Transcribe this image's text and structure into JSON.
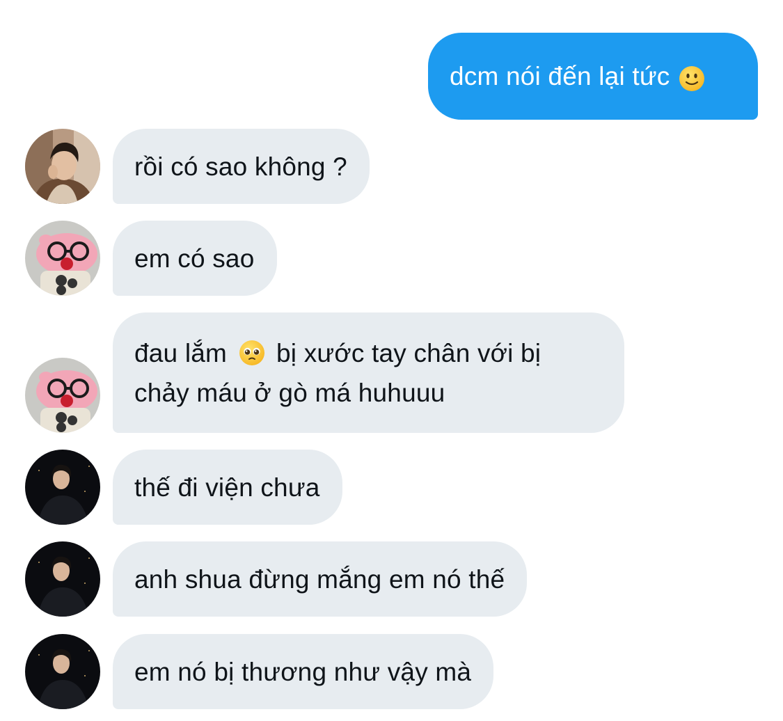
{
  "conversation": {
    "messages": [
      {
        "direction": "outgoing",
        "text": "dcm nói đến lại tức",
        "emoji": "slightly-smiling-face-icon"
      },
      {
        "direction": "incoming",
        "avatar": "avatar-man-brown-coat",
        "text": "rồi có sao không ?"
      },
      {
        "direction": "incoming",
        "avatar": "avatar-pink-plush-glasses",
        "text": "em có sao"
      },
      {
        "direction": "incoming",
        "avatar": "avatar-pink-plush-glasses",
        "lines": [
          "đau lắm",
          "bị xước tay chân với bị",
          "chảy máu ở gò má huhuuu"
        ],
        "emoji": "pleading-face-icon"
      },
      {
        "direction": "incoming",
        "avatar": "avatar-man-dark-background",
        "text": "thế đi viện chưa"
      },
      {
        "direction": "incoming",
        "avatar": "avatar-man-dark-background",
        "text": "anh shua đừng mắng em nó thế"
      },
      {
        "direction": "incoming",
        "avatar": "avatar-man-dark-background",
        "text": "em nó bị thương như vậy mà"
      }
    ]
  },
  "colors": {
    "outgoing_bubble": "#1d9bf0",
    "incoming_bubble": "#e7ecf0",
    "text_dark": "#0f1419"
  }
}
